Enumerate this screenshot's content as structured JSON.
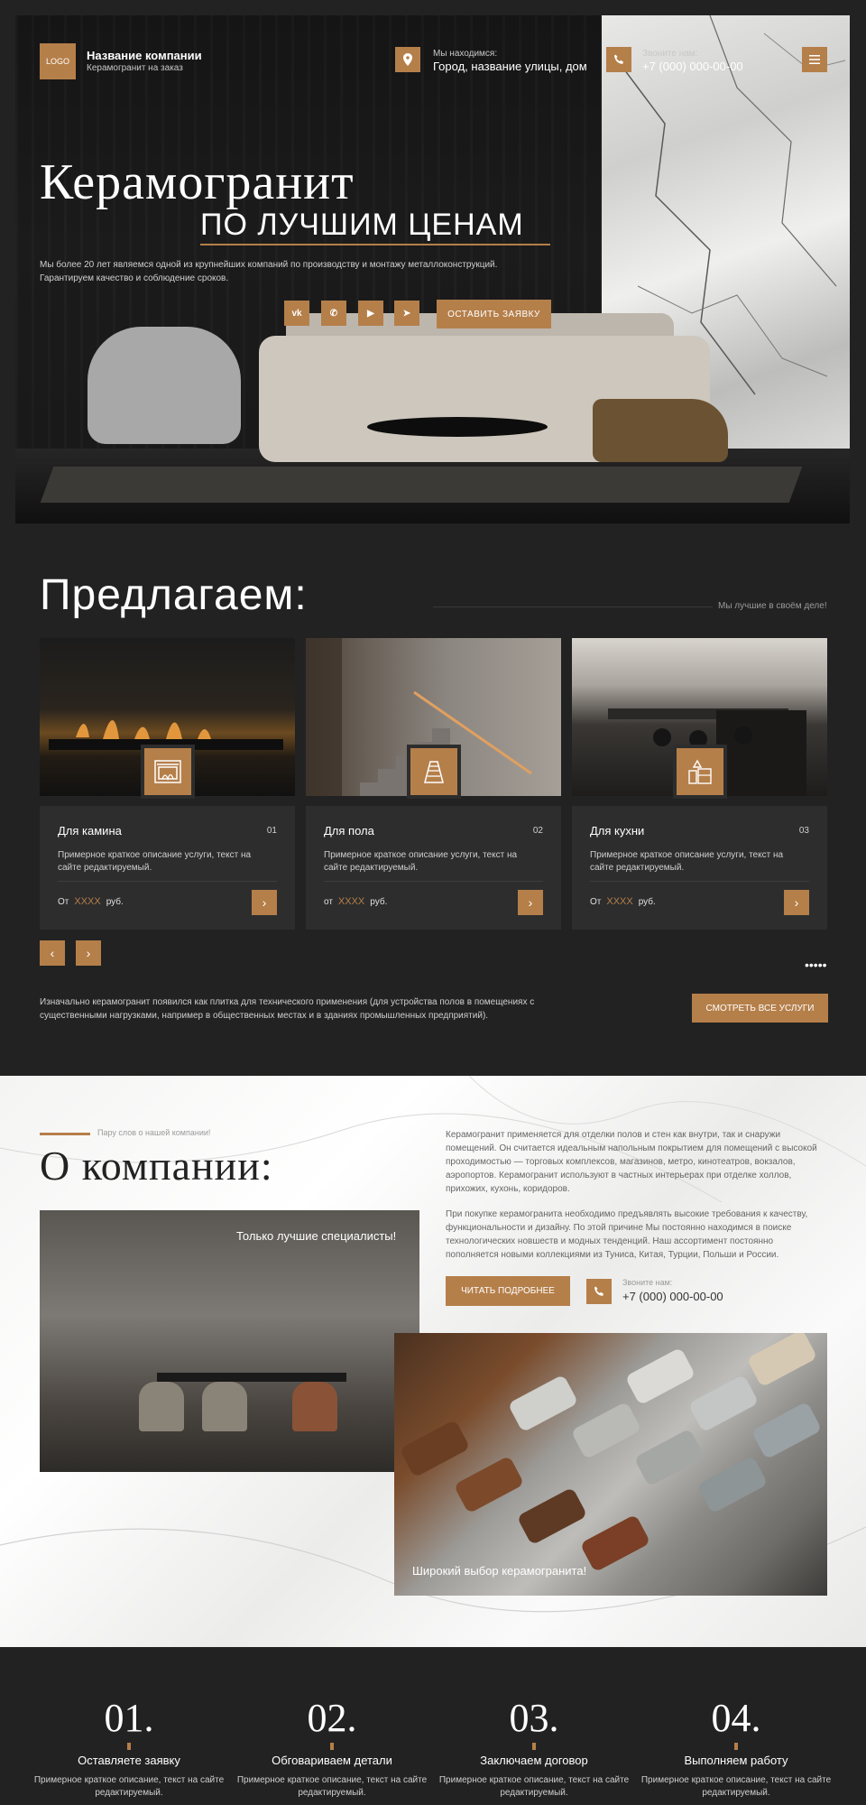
{
  "colors": {
    "accent": "#b57f4a",
    "dark": "#222222",
    "card": "#2d2d2d"
  },
  "header": {
    "logo": "LOGO",
    "company_name": "Название компании",
    "company_sub": "Керамогранит на заказ",
    "location_label": "Мы находимся:",
    "location_value": "Город, название улицы, дом",
    "phone_label": "Звоните нам:",
    "phone_value": "+7 (000) 000-00-00",
    "icons": {
      "location": "map-pin-icon",
      "phone": "phone-icon",
      "menu": "menu-icon"
    }
  },
  "hero": {
    "title": "Керамогранит",
    "subtitle": "ПО ЛУЧШИМ ЦЕНАМ",
    "text": "Мы более 20 лет являемся одной из крупнейших компаний по производству и монтажу металлоконструкций. Гарантируем качество и соблюдение сроков.",
    "socials": [
      {
        "label": "vk",
        "icon": "vk-icon"
      },
      {
        "label": "✆",
        "icon": "whatsapp-icon"
      },
      {
        "label": "▶",
        "icon": "youtube-icon"
      },
      {
        "label": "➤",
        "icon": "telegram-icon"
      }
    ],
    "cta": "ОСТАВИТЬ ЗАЯВКУ"
  },
  "offers": {
    "title": "Предлагаем:",
    "tagline": "Мы лучшие в своём деле!",
    "cards": [
      {
        "title": "Для камина",
        "num": "01",
        "desc": "Примерное краткое описание услуги, текст на сайте редактируемый.",
        "price_prefix": "От",
        "price": "XXXX",
        "currency": "руб.",
        "icon": "fireplace-icon"
      },
      {
        "title": "Для пола",
        "num": "02",
        "desc": "Примерное краткое описание услуги, текст на сайте редактируемый.",
        "price_prefix": "от",
        "price": "XXXX",
        "currency": "руб.",
        "icon": "stairs-icon"
      },
      {
        "title": "Для кухни",
        "num": "03",
        "desc": "Примерное краткое описание услуги, текст на сайте редактируемый.",
        "price_prefix": "От",
        "price": "XXXX",
        "currency": "руб.",
        "icon": "kitchen-icon"
      }
    ],
    "dots": "•••••",
    "note": "Изначально керамогранит появился как плитка для технического применения (для устройства полов в помещениях с существенными нагрузками, например в общественных местах и в зданиях промышленных предприятий).",
    "all_button": "СМОТРЕТЬ ВСЕ УСЛУГИ"
  },
  "about": {
    "tagline": "Пару слов о нашей компании!",
    "title": "О компании:",
    "p1": "Керамогранит применяется для отделки полов и стен как внутри, так и снаружи помещений. Он считается идеальным напольным покрытием для помещений с высокой проходимостью — торговых комплексов, магазинов, метро, кинотеатров, вокзалов, аэропортов. Керамогранит используют в частных интерьерах при отделке холлов, прихожих, кухонь, коридоров.",
    "p2": "При покупке керамогранита необходимо предъявлять высокие требования к качеству, функциональности и дизайну. По этой причине Мы постоянно находимся в поиске технологических новшеств и модных тенденций. Наш ассортимент постоянно пополняется новыми коллекциями из Туниса, Китая, Турции, Польши и России.",
    "read_more": "ЧИТАТЬ ПОДРОБНЕЕ",
    "phone_label": "Звоните нам:",
    "phone_value": "+7 (000) 000-00-00",
    "interior_caption": "Только лучшие специалисты!",
    "samples_caption": "Широкий выбор керамогранита!"
  },
  "steps": [
    {
      "num": "01.",
      "title": "Оставляете заявку",
      "desc": "Примерное краткое описание, текст на сайте редактируемый."
    },
    {
      "num": "02.",
      "title": "Обговариваем детали",
      "desc": "Примерное краткое описание, текст на сайте редактируемый."
    },
    {
      "num": "03.",
      "title": "Заключаем договор",
      "desc": "Примерное краткое описание, текст на сайте редактируемый."
    },
    {
      "num": "04.",
      "title": "Выполняем работу",
      "desc": "Примерное краткое описание, текст на сайте редактируемый."
    }
  ]
}
